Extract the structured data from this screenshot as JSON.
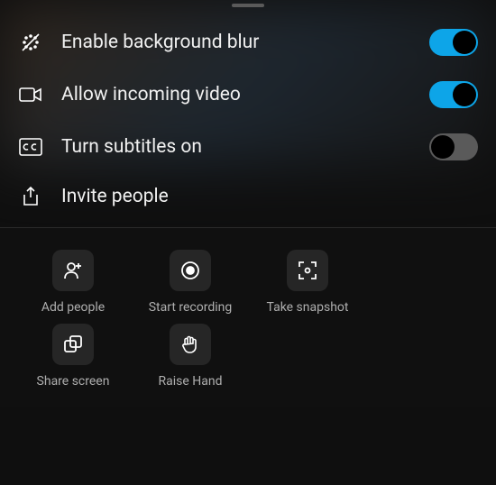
{
  "settings": [
    {
      "id": "blur",
      "icon": "blur-icon",
      "label": "Enable background blur",
      "toggle": true,
      "enabled": true
    },
    {
      "id": "incoming-video",
      "icon": "video-icon",
      "label": "Allow incoming video",
      "toggle": true,
      "enabled": true
    },
    {
      "id": "subtitles",
      "icon": "cc-icon",
      "label": "Turn subtitles on",
      "toggle": true,
      "enabled": false
    },
    {
      "id": "invite",
      "icon": "share-icon",
      "label": "Invite people",
      "toggle": false
    }
  ],
  "actions": [
    {
      "id": "add-people",
      "icon": "add-person-icon",
      "label": "Add people"
    },
    {
      "id": "start-recording",
      "icon": "record-icon",
      "label": "Start recording"
    },
    {
      "id": "take-snapshot",
      "icon": "snapshot-icon",
      "label": "Take snapshot"
    },
    {
      "id": "share-screen",
      "icon": "share-screen-icon",
      "label": "Share screen"
    },
    {
      "id": "raise-hand",
      "icon": "raise-hand-icon",
      "label": "Raise Hand"
    }
  ]
}
